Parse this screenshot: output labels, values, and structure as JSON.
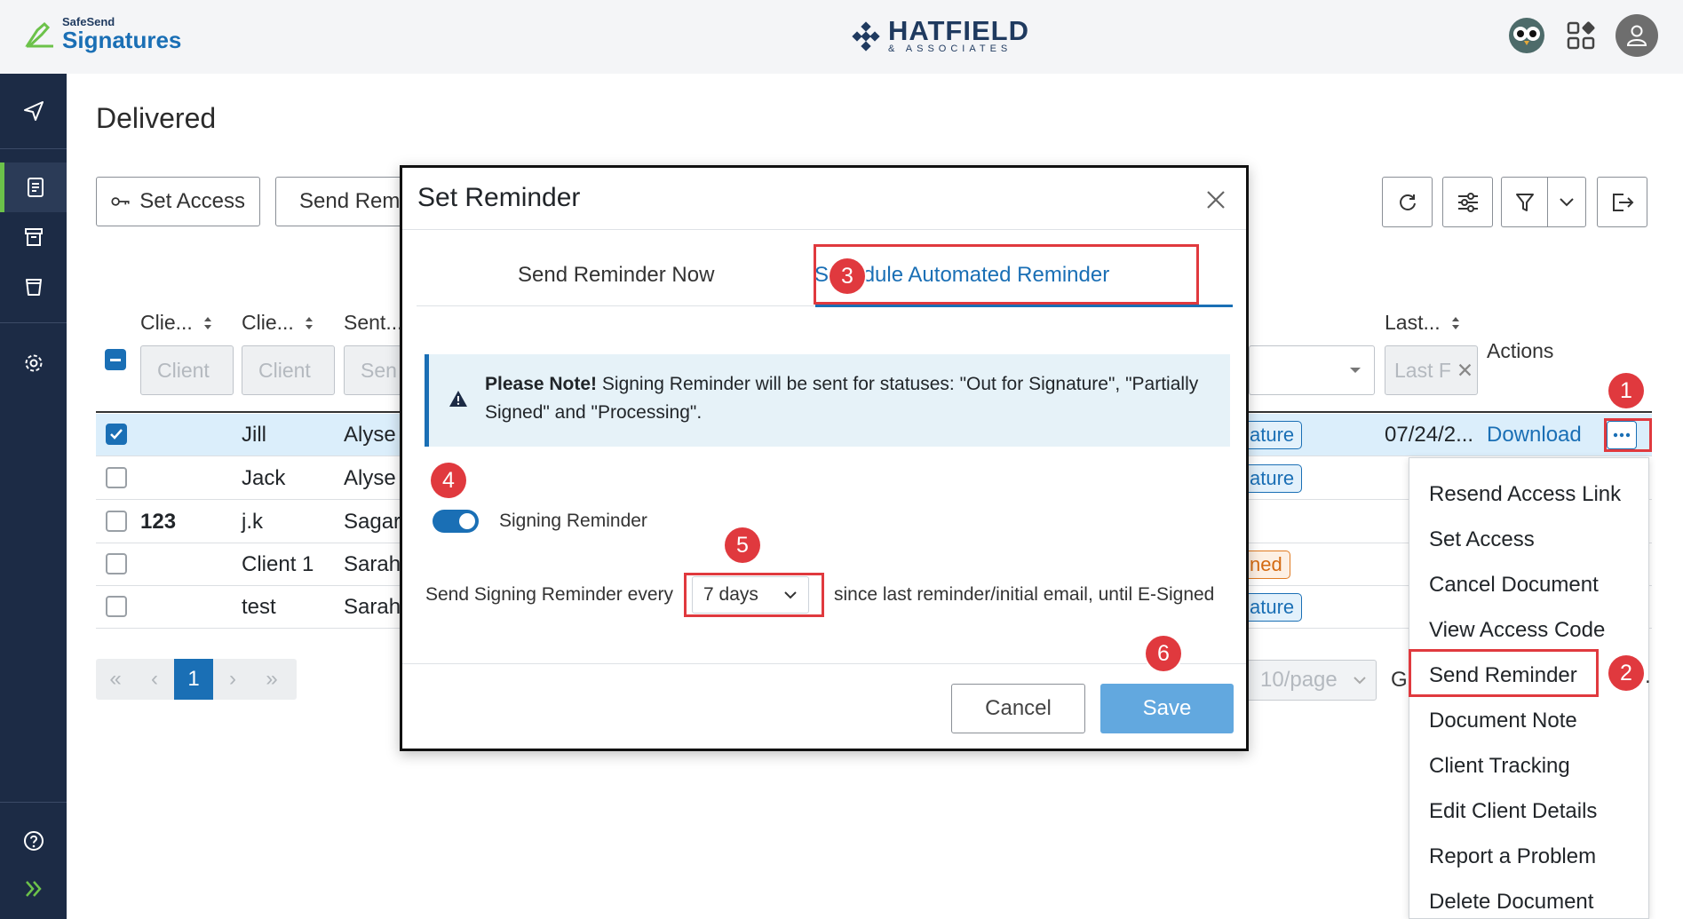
{
  "header": {
    "logo_small": "SafeSend",
    "logo_big": "Signatures",
    "brand_name": "HATFIELD",
    "brand_sub": "& ASSOCIATES"
  },
  "sidebar": {
    "icons": [
      "send-icon",
      "document-icon",
      "archive-icon",
      "recycle-bin-icon",
      "settings-icon",
      "help-icon",
      "expand-icon"
    ]
  },
  "page": {
    "title": "Delivered"
  },
  "toolbar": {
    "set_access": "Set Access",
    "send_reminder": "Send Reminder"
  },
  "table": {
    "headers": {
      "client_id": "Clie...",
      "client_name": "Clie...",
      "sent_by": "Sent...",
      "last": "Last...",
      "actions": "Actions"
    },
    "filters": {
      "client_id": "Client",
      "client_name": "Client",
      "sent_by": "Sen",
      "last": "Last F"
    },
    "rows": [
      {
        "id": "",
        "name": "Jill",
        "sent": "Alyse",
        "status": "ature",
        "last": "07/24/2...",
        "action": "Download",
        "checked": true
      },
      {
        "id": "",
        "name": "Jack",
        "sent": "Alyse",
        "status": "ature",
        "last": "",
        "action": "",
        "checked": false
      },
      {
        "id": "123",
        "name": "j.k",
        "sent": "Sagar",
        "status": "",
        "last": "",
        "action": "",
        "checked": false
      },
      {
        "id": "",
        "name": "Client 1",
        "sent": "Sarah",
        "status": "ned",
        "last": "",
        "action": "",
        "checked": false
      },
      {
        "id": "",
        "name": "test",
        "sent": "Sarah",
        "status": "ature",
        "last": "",
        "action": "",
        "checked": false
      }
    ]
  },
  "pagination": {
    "current": "1",
    "per_page": "10/page",
    "goto": "G"
  },
  "modal": {
    "title": "Set Reminder",
    "tab_now": "Send Reminder Now",
    "tab_schedule": "Schedule Automated Reminder",
    "note_bold": "Please Note!",
    "note_text": " Signing Reminder will be sent for statuses: \"Out for Signature\", \"Partially Signed\" and \"Processing\".",
    "toggle_label": "Signing Reminder",
    "every_label": "Send Signing Reminder every",
    "days_value": "7 days",
    "since_label": "since last reminder/initial email, until E-Signed",
    "cancel": "Cancel",
    "save": "Save"
  },
  "actions_menu": {
    "items": [
      "Resend Access Link",
      "Set Access",
      "Cancel Document",
      "View Access Code",
      "Send Reminder",
      "Document Note",
      "Client Tracking",
      "Edit Client Details",
      "Report a Problem",
      "Delete Document"
    ]
  },
  "annotations": {
    "markers": [
      "1",
      "2",
      "3",
      "4",
      "5",
      "6"
    ]
  }
}
